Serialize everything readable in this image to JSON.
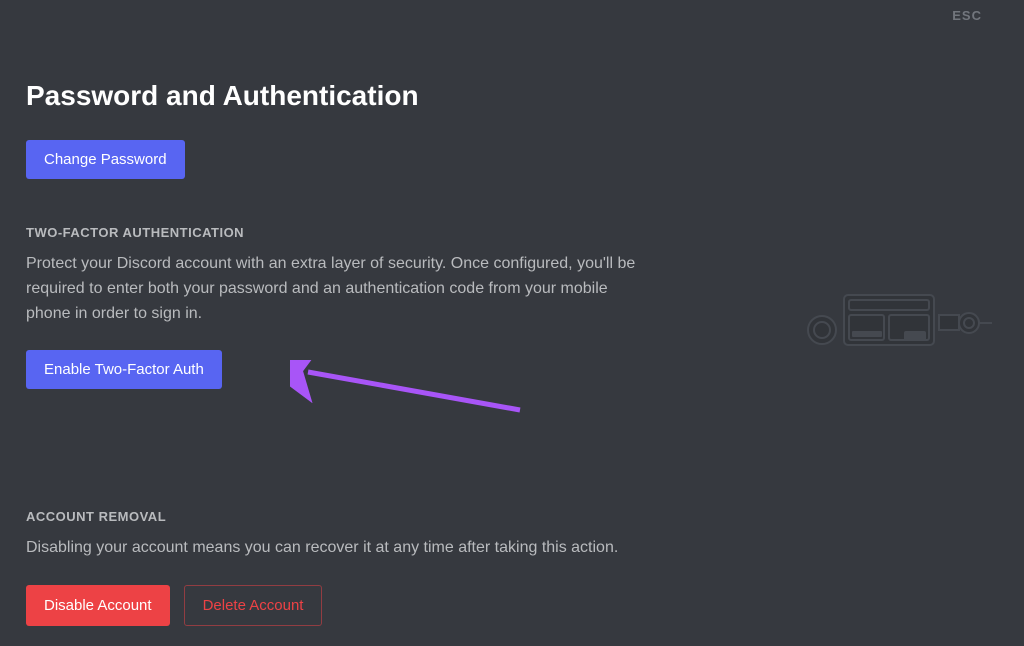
{
  "esc": "ESC",
  "title": "Password and Authentication",
  "changePasswordButton": "Change Password",
  "twoFactor": {
    "label": "TWO-FACTOR AUTHENTICATION",
    "description": "Protect your Discord account with an extra layer of security. Once configured, you'll be required to enter both your password and an authentication code from your mobile phone in order to sign in.",
    "enableButton": "Enable Two-Factor Auth"
  },
  "accountRemoval": {
    "label": "ACCOUNT REMOVAL",
    "description": "Disabling your account means you can recover it at any time after taking this action.",
    "disableButton": "Disable Account",
    "deleteButton": "Delete Account"
  }
}
